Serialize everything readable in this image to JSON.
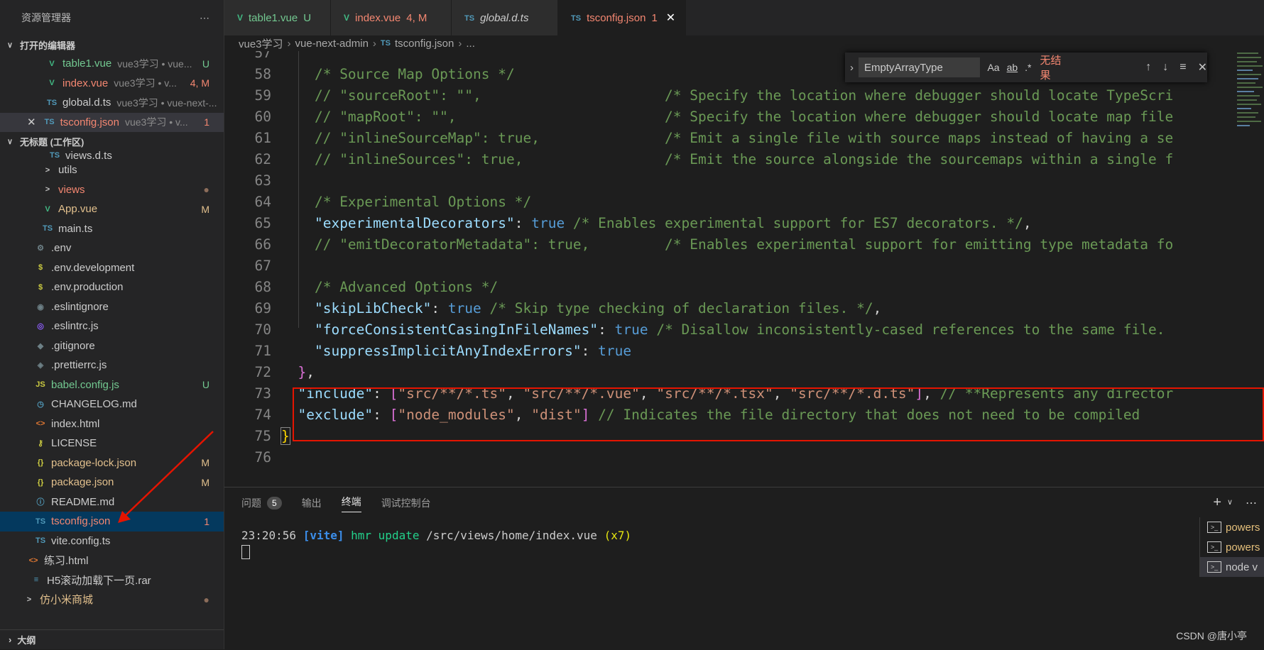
{
  "explorer": {
    "title": "资源管理器",
    "more_icon": "ellipsis-icon",
    "open_editors_label": "打开的编辑器",
    "open_editors": [
      {
        "name": "table1.vue",
        "desc": "vue3学习 • vue...",
        "badge": "U",
        "color": "#73c991",
        "icon": "vue"
      },
      {
        "name": "index.vue",
        "desc": "vue3学习 • v...",
        "badge": "4, M",
        "color": "#f48771",
        "icon": "vue"
      },
      {
        "name": "global.d.ts",
        "desc": "vue3学习 • vue-next-...",
        "badge": "",
        "color": "#cccccc",
        "icon": "ts"
      },
      {
        "name": "tsconfig.json",
        "desc": "vue3学习 • v...",
        "badge": "1",
        "color": "#f48771",
        "icon": "ts"
      }
    ],
    "workspace_label": "无标题 (工作区)",
    "files": [
      {
        "name": "views.d.ts",
        "badge": "",
        "color": "#cccccc",
        "icon": "TS"
      },
      {
        "name": "utils",
        "badge": "",
        "color": "#cccccc",
        "icon": ">"
      },
      {
        "name": "views",
        "badge": "●",
        "color": "#f48771",
        "icon": ">"
      },
      {
        "name": "App.vue",
        "badge": "M",
        "color": "#e2c08d",
        "icon": "V"
      },
      {
        "name": "main.ts",
        "badge": "",
        "color": "#cccccc",
        "icon": "TS"
      },
      {
        "name": ".env",
        "badge": "",
        "color": "#cccccc",
        "icon": "⚙"
      },
      {
        "name": ".env.development",
        "badge": "",
        "color": "#cccccc",
        "icon": "$"
      },
      {
        "name": ".env.production",
        "badge": "",
        "color": "#cccccc",
        "icon": "$"
      },
      {
        "name": ".eslintignore",
        "badge": "",
        "color": "#cccccc",
        "icon": "◉"
      },
      {
        "name": ".eslintrc.js",
        "badge": "",
        "color": "#cccccc",
        "icon": "◎"
      },
      {
        "name": ".gitignore",
        "badge": "",
        "color": "#cccccc",
        "icon": "◆"
      },
      {
        "name": ".prettierrc.js",
        "badge": "",
        "color": "#cccccc",
        "icon": "◈"
      },
      {
        "name": "babel.config.js",
        "badge": "U",
        "color": "#73c991",
        "icon": "JS"
      },
      {
        "name": "CHANGELOG.md",
        "badge": "",
        "color": "#cccccc",
        "icon": "◷"
      },
      {
        "name": "index.html",
        "badge": "",
        "color": "#cccccc",
        "icon": "<>"
      },
      {
        "name": "LICENSE",
        "badge": "",
        "color": "#cccccc",
        "icon": "⚷"
      },
      {
        "name": "package-lock.json",
        "badge": "M",
        "color": "#e2c08d",
        "icon": "{}"
      },
      {
        "name": "package.json",
        "badge": "M",
        "color": "#e2c08d",
        "icon": "{}"
      },
      {
        "name": "README.md",
        "badge": "",
        "color": "#cccccc",
        "icon": "ⓘ"
      },
      {
        "name": "tsconfig.json",
        "badge": "1",
        "color": "#f48771",
        "icon": "TS"
      },
      {
        "name": "vite.config.ts",
        "badge": "",
        "color": "#cccccc",
        "icon": "TS"
      },
      {
        "name": "练习.html",
        "badge": "",
        "color": "#cccccc",
        "icon": "<>"
      },
      {
        "name": "H5滚动加载下一页.rar",
        "badge": "",
        "color": "#cccccc",
        "icon": "≡"
      },
      {
        "name": "仿小米商城",
        "badge": "●",
        "color": "#e2c08d",
        "icon": ">"
      }
    ],
    "outline_label": "大纲"
  },
  "tabs": [
    {
      "label": "table1.vue",
      "suffix": "U",
      "color": "#73c991",
      "icon": "vue",
      "active": false
    },
    {
      "label": "index.vue",
      "suffix": "4, M",
      "color": "#f48771",
      "icon": "vue",
      "active": false
    },
    {
      "label": "global.d.ts",
      "suffix": "",
      "color": "#cccccc",
      "icon": "ts",
      "active": false
    },
    {
      "label": "tsconfig.json",
      "suffix": "1",
      "color": "#f48771",
      "icon": "ts",
      "active": true
    }
  ],
  "breadcrumb": [
    "vue3学习",
    "vue-next-admin",
    "tsconfig.json",
    "..."
  ],
  "find_widget": {
    "query": "EmptyArrayType",
    "match_case": "Aa",
    "whole_word": "ab",
    "regex": ".*",
    "result": "无结果"
  },
  "code_lines": [
    {
      "n": "57",
      "t": [
        [
          "",
          ""
        ]
      ]
    },
    {
      "n": "58",
      "t": [
        [
          "    ",
          "c-pun"
        ],
        [
          "/* Source Map Options */",
          "c-cm"
        ]
      ]
    },
    {
      "n": "59",
      "t": [
        [
          "    ",
          "c-pun"
        ],
        [
          "// \"sourceRoot\": \"\",                      /* Specify the location where debugger should locate TypeScri",
          "c-cm"
        ]
      ]
    },
    {
      "n": "60",
      "t": [
        [
          "    ",
          "c-pun"
        ],
        [
          "// \"mapRoot\": \"\",                         /* Specify the location where debugger should locate map file",
          "c-cm"
        ]
      ]
    },
    {
      "n": "61",
      "t": [
        [
          "    ",
          "c-pun"
        ],
        [
          "// \"inlineSourceMap\": true,               /* Emit a single file with source maps instead of having a se",
          "c-cm"
        ]
      ]
    },
    {
      "n": "62",
      "t": [
        [
          "    ",
          "c-pun"
        ],
        [
          "// \"inlineSources\": true,                 /* Emit the source alongside the sourcemaps within a single f",
          "c-cm"
        ]
      ]
    },
    {
      "n": "63",
      "t": [
        [
          "",
          ""
        ]
      ]
    },
    {
      "n": "64",
      "t": [
        [
          "    ",
          "c-pun"
        ],
        [
          "/* Experimental Options */",
          "c-cm"
        ]
      ]
    },
    {
      "n": "65",
      "t": [
        [
          "    ",
          "c-pun"
        ],
        [
          "\"experimentalDecorators\"",
          "c-key"
        ],
        [
          ": ",
          "c-pun"
        ],
        [
          "true",
          "c-bool"
        ],
        [
          " /* Enables experimental support for ES7 decorators. */",
          "c-cm"
        ],
        [
          ",",
          "c-pun"
        ]
      ]
    },
    {
      "n": "66",
      "t": [
        [
          "    ",
          "c-pun"
        ],
        [
          "// \"emitDecoratorMetadata\": true,         /* Enables experimental support for emitting type metadata fo",
          "c-cm"
        ]
      ]
    },
    {
      "n": "67",
      "t": [
        [
          "",
          ""
        ]
      ]
    },
    {
      "n": "68",
      "t": [
        [
          "    ",
          "c-pun"
        ],
        [
          "/* Advanced Options */",
          "c-cm"
        ]
      ]
    },
    {
      "n": "69",
      "t": [
        [
          "    ",
          "c-pun"
        ],
        [
          "\"skipLibCheck\"",
          "c-key"
        ],
        [
          ": ",
          "c-pun"
        ],
        [
          "true",
          "c-bool"
        ],
        [
          " /* Skip type checking of declaration files. */",
          "c-cm"
        ],
        [
          ",",
          "c-pun"
        ]
      ]
    },
    {
      "n": "70",
      "t": [
        [
          "    ",
          "c-pun"
        ],
        [
          "\"forceConsistentCasingInFileNames\"",
          "c-key"
        ],
        [
          ": ",
          "c-pun"
        ],
        [
          "true",
          "c-bool"
        ],
        [
          " /* Disallow inconsistently-cased references to the same file.",
          "c-cm"
        ]
      ]
    },
    {
      "n": "71",
      "t": [
        [
          "    ",
          "c-pun"
        ],
        [
          "\"suppressImplicitAnyIndexErrors\"",
          "c-key"
        ],
        [
          ": ",
          "c-pun"
        ],
        [
          "true",
          "c-bool"
        ]
      ]
    },
    {
      "n": "72",
      "t": [
        [
          "  ",
          "c-pun"
        ],
        [
          "}",
          "c-br1"
        ],
        [
          ",",
          "c-pun"
        ]
      ]
    },
    {
      "n": "73",
      "t": [
        [
          "  ",
          "c-pun"
        ],
        [
          "\"include\"",
          "c-key"
        ],
        [
          ": ",
          "c-pun"
        ],
        [
          "[",
          "c-br1"
        ],
        [
          "\"src/**/*.ts\"",
          "c-str"
        ],
        [
          ", ",
          "c-pun"
        ],
        [
          "\"src/**/*.vue\"",
          "c-str"
        ],
        [
          ", ",
          "c-pun"
        ],
        [
          "\"src/**/*.tsx\"",
          "c-str"
        ],
        [
          ", ",
          "c-pun"
        ],
        [
          "\"src/**/*.d.ts\"",
          "c-str"
        ],
        [
          "]",
          "c-br1"
        ],
        [
          ", ",
          "c-pun"
        ],
        [
          "// **Represents any director",
          "c-cm"
        ]
      ]
    },
    {
      "n": "74",
      "t": [
        [
          "  ",
          "c-pun"
        ],
        [
          "\"exclude\"",
          "c-key"
        ],
        [
          ": ",
          "c-pun"
        ],
        [
          "[",
          "c-br1"
        ],
        [
          "\"node_modules\"",
          "c-str"
        ],
        [
          ", ",
          "c-pun"
        ],
        [
          "\"dist\"",
          "c-str"
        ],
        [
          "]",
          "c-br1"
        ],
        [
          " // Indicates the file directory that does not need to be compiled",
          "c-cm"
        ]
      ]
    },
    {
      "n": "75",
      "t": [
        [
          "}",
          "c-br2"
        ]
      ]
    },
    {
      "n": "76",
      "t": [
        [
          "",
          ""
        ]
      ]
    }
  ],
  "panel": {
    "tabs": [
      "问题",
      "输出",
      "终端",
      "调试控制台"
    ],
    "problems_count": "5",
    "active_tab": "终端",
    "terminal": {
      "time": "23:20:56",
      "tag": "[vite]",
      "action": "hmr update",
      "path": " /src/views/home/index.vue ",
      "count": "(x7)"
    },
    "terminals": [
      "powers",
      "powers",
      "node v"
    ],
    "add_label": "+"
  },
  "watermark": "CSDN @唐小亭"
}
